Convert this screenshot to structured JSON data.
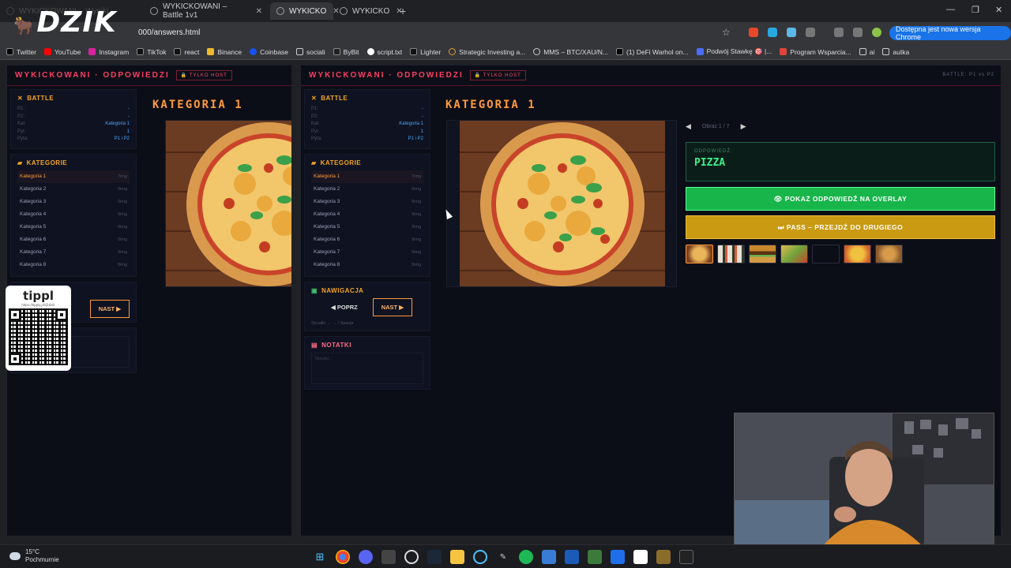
{
  "browser": {
    "tabs": [
      {
        "label": "WYKICKOWANI – Wyniki"
      },
      {
        "label": "WYKICKOWANI – Battle 1v1"
      },
      {
        "label": "WYKICKO"
      },
      {
        "label": "WYKICKO"
      }
    ],
    "logo_text": "DZIK",
    "address": "000/answers.html",
    "update_label": "Dostępna jest nowa wersja Chrome",
    "bookmarks": [
      "Twitter",
      "YouTube",
      "Instagram",
      "TikTok",
      "react",
      "Binance",
      "Coinbase",
      "sociali",
      "ByBit",
      "script.txt",
      "Lighter",
      "Strategic Investing a...",
      "MMS – BTC/XAU/N...",
      "(1) DeFi Warhol on...",
      "Podwój Stawkę 🎯 |...",
      "Program Wsparcia...",
      "ai",
      "autka"
    ]
  },
  "app": {
    "title": "WYKICKOWANI · ODPOWIEDZI",
    "host_badge": "🔒 TYLKO HOST",
    "battle_tag": "BATTLE: P1 vs P2",
    "battle_panel": {
      "title": "BATTLE",
      "rows": [
        {
          "k": "P1:",
          "v": "-"
        },
        {
          "k": "P2:",
          "v": "-"
        },
        {
          "k": "Kat:",
          "v": "Kategoria 1"
        },
        {
          "k": "Pyt:",
          "v": "1"
        },
        {
          "k": "Pyta:",
          "v": "P1 i P2"
        }
      ]
    },
    "categories_panel": {
      "title": "KATEGORIE",
      "items": [
        {
          "name": "Kategoria 1",
          "count": "7img"
        },
        {
          "name": "Kategoria 2",
          "count": "0img"
        },
        {
          "name": "Kategoria 3",
          "count": "0img"
        },
        {
          "name": "Kategoria 4",
          "count": "0img"
        },
        {
          "name": "Kategoria 5",
          "count": "0img"
        },
        {
          "name": "Kategoria 6",
          "count": "0img"
        },
        {
          "name": "Kategoria 7",
          "count": "0img"
        },
        {
          "name": "Kategoria 8",
          "count": "0img"
        }
      ]
    },
    "nav_panel": {
      "title": "NAWIGACJA",
      "prev": "◀ POPRZ",
      "next": "NAST ▶",
      "hint": "Strzałki ← → / Spacja"
    },
    "notes_panel": {
      "title": "NOTATKI",
      "placeholder": "Notatki..."
    },
    "category_title": "KATEGORIA 1",
    "image_nav": {
      "prev": "◀",
      "label": "Obraz 1 / 7",
      "next": "▶"
    },
    "answer": {
      "label": "ODPOWIEDŹ:",
      "value": "PIZZA"
    },
    "show_button": "👁 POKAŻ ODPOWIEDŹ NA OVERLAY",
    "pass_button": "⏭ PASS – PRZEJDŹ DO DRUGIEGO"
  },
  "overlay": {
    "qr_brand": "tippl",
    "qr_url": "https://tipply.pl/@dzik"
  },
  "taskbar": {
    "temp": "15°C",
    "weather": "Pochmurnie"
  },
  "colors": {
    "accent_red": "#ff3d63",
    "accent_orange": "#ff9a3c",
    "answer_green": "#3cf08a",
    "show_button": "#18b54a",
    "pass_button": "#c99a12"
  }
}
